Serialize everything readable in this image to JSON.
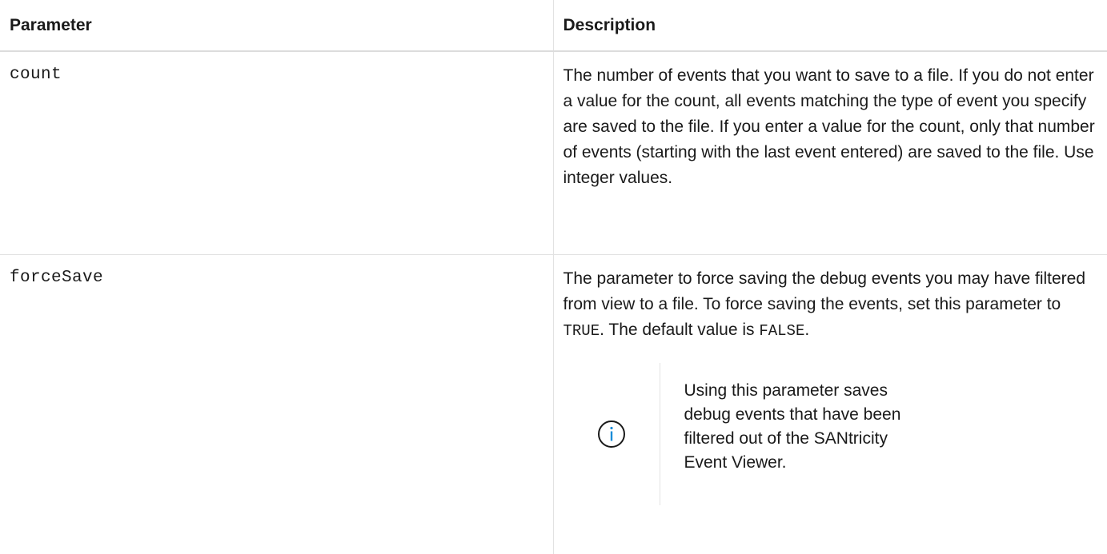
{
  "table": {
    "headers": {
      "parameter": "Parameter",
      "description": "Description"
    },
    "rows": [
      {
        "param": "count",
        "desc": "The number of events that you want to save to a file. If you do not enter a value for the count, all events matching the type of event you specify are saved to the file. If you enter a value for the count, only that number of events (starting with the last event entered) are saved to the file. Use integer values."
      },
      {
        "param": "forceSave",
        "desc_parts": {
          "before_true": "The parameter to force saving the debug events you may have filtered from view to a file. To force saving the events, set this parameter to ",
          "true_value": "TRUE",
          "between": ". The default value is ",
          "false_value": "FALSE",
          "after": "."
        },
        "note": {
          "icon": "info-icon",
          "text": "Using this parameter saves debug events that have been filtered out of the SANtricity Event Viewer."
        }
      }
    ]
  }
}
